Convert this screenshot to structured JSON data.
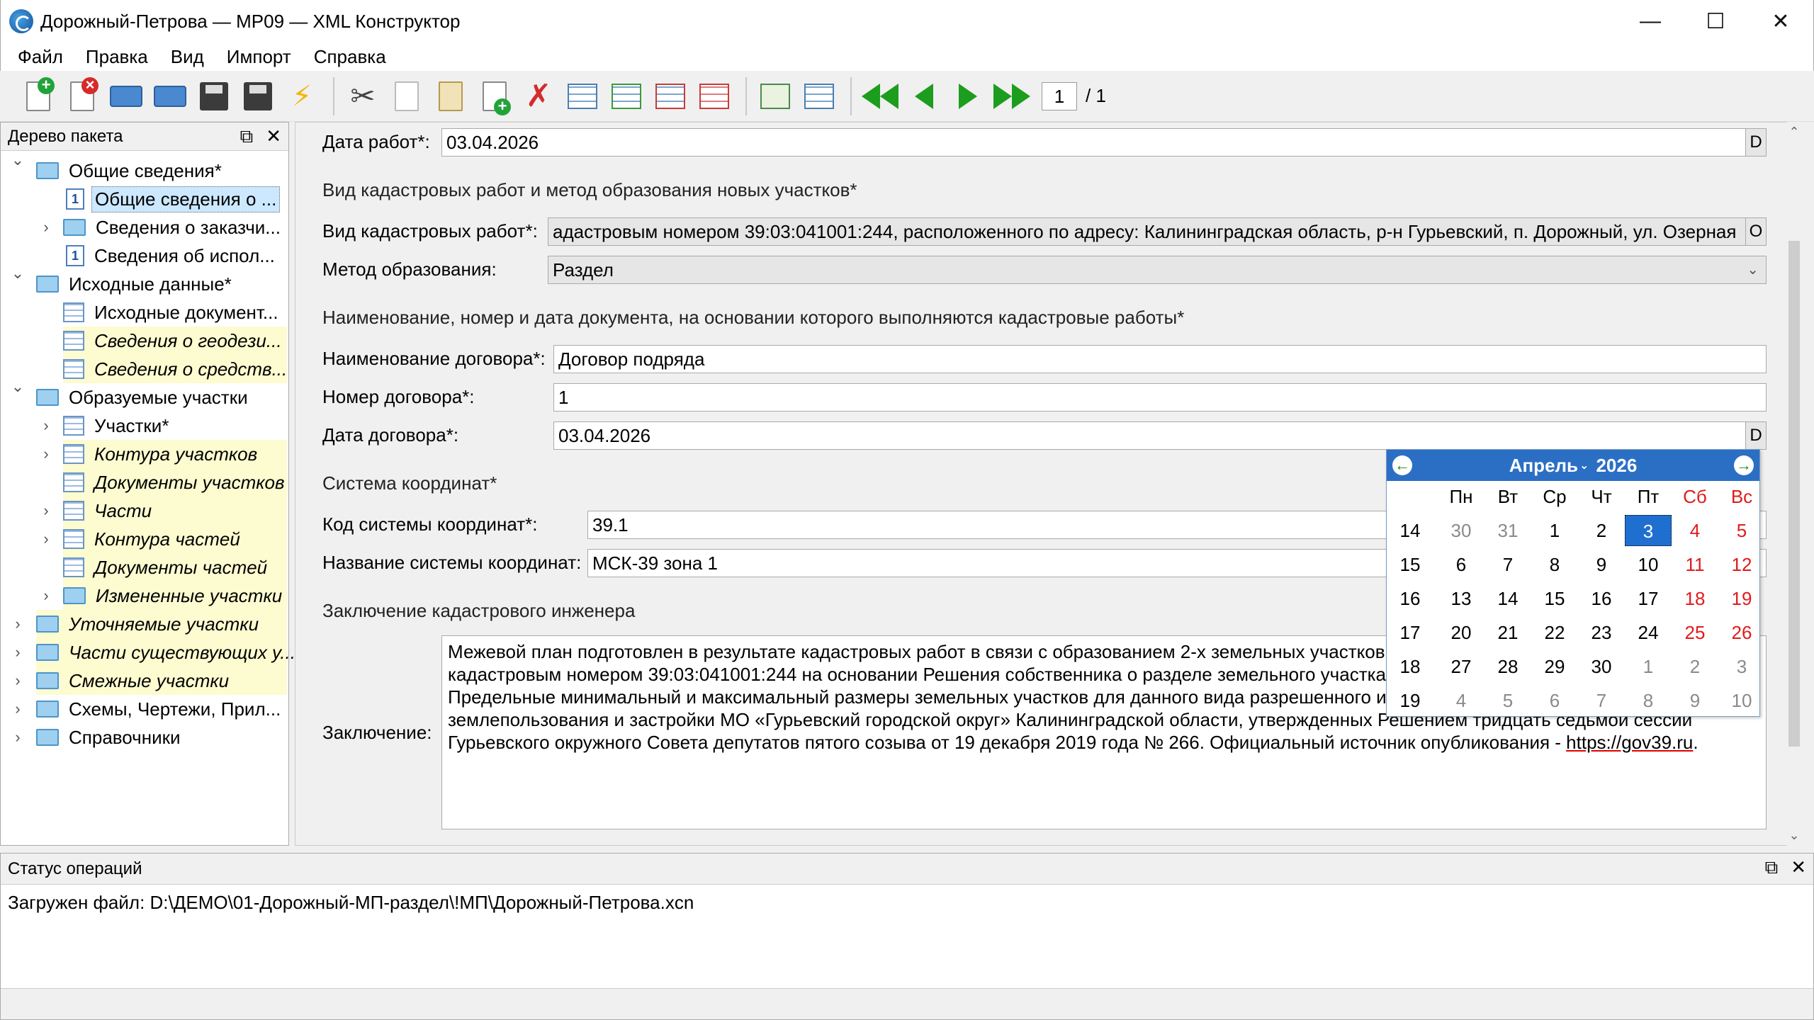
{
  "window": {
    "title": "Дорожный-Петрова — МР09 — XML Конструктор",
    "minimize": "—",
    "maximize": "☐",
    "close": "✕"
  },
  "menu": [
    "Файл",
    "Правка",
    "Вид",
    "Импорт",
    "Справка"
  ],
  "toolbar": {
    "page_current": "1",
    "page_total": "/ 1"
  },
  "tree": {
    "header": "Дерево пакета",
    "items": [
      {
        "label": "Общие сведения*",
        "expander": "v",
        "icon": "folder",
        "italic": false,
        "highlight": false
      },
      {
        "label": "Общие сведения о ...",
        "expander": "",
        "icon": "doc1",
        "italic": false,
        "highlight": false,
        "selected": true
      },
      {
        "label": "Сведения о заказчи...",
        "expander": ">",
        "icon": "folder",
        "italic": false,
        "highlight": false
      },
      {
        "label": "Сведения об испол...",
        "expander": "",
        "icon": "doc1",
        "italic": false,
        "highlight": false
      },
      {
        "label": "Исходные данные*",
        "expander": "v",
        "icon": "folder",
        "italic": false,
        "highlight": false
      },
      {
        "label": "Исходные документ...",
        "expander": "",
        "icon": "table",
        "italic": false,
        "highlight": false
      },
      {
        "label": "Сведения о геодези...",
        "expander": "",
        "icon": "table",
        "italic": true,
        "highlight": true
      },
      {
        "label": "Сведения о средств...",
        "expander": "",
        "icon": "table",
        "italic": true,
        "highlight": true
      },
      {
        "label": "Образуемые участки",
        "expander": "v",
        "icon": "folder",
        "italic": false,
        "highlight": false
      },
      {
        "label": "Участки*",
        "expander": ">",
        "icon": "table",
        "italic": false,
        "highlight": false
      },
      {
        "label": "Контура участков",
        "expander": ">",
        "icon": "table",
        "italic": true,
        "highlight": true
      },
      {
        "label": "Документы участков",
        "expander": "",
        "icon": "table",
        "italic": true,
        "highlight": true
      },
      {
        "label": "Части",
        "expander": ">",
        "icon": "table",
        "italic": true,
        "highlight": true
      },
      {
        "label": "Контура частей",
        "expander": ">",
        "icon": "table",
        "italic": true,
        "highlight": true
      },
      {
        "label": "Документы частей",
        "expander": "",
        "icon": "table",
        "italic": true,
        "highlight": true
      },
      {
        "label": "Измененные участки",
        "expander": ">",
        "icon": "folder",
        "italic": true,
        "highlight": true
      },
      {
        "label": "Уточняемые участки",
        "expander": ">",
        "icon": "folder",
        "italic": true,
        "highlight": true
      },
      {
        "label": "Части существующих у...",
        "expander": ">",
        "icon": "folder",
        "italic": true,
        "highlight": true
      },
      {
        "label": "Смежные участки",
        "expander": ">",
        "icon": "folder",
        "italic": true,
        "highlight": true
      },
      {
        "label": "Схемы, Чертежи, Прил...",
        "expander": ">",
        "icon": "folder",
        "italic": false,
        "highlight": false
      },
      {
        "label": "Справочники",
        "expander": ">",
        "icon": "folder",
        "italic": false,
        "highlight": false
      }
    ]
  },
  "form": {
    "work_date_label": "Дата работ*:",
    "work_date_value": "03.04.2026",
    "d_button": "D",
    "section_kind": "Вид кадастровых работ и метод образования новых участков*",
    "kind_label": "Вид кадастровых работ*:",
    "kind_value": "адастровым номером 39:03:041001:244, расположенного по адресу: Калининградская область, р-н Гурьевский, п. Дорожный, ул. Озерная",
    "o_button": "O",
    "method_label": "Метод образования:",
    "method_value": "Раздел",
    "section_doc": "Наименование, номер и дата документа, на основании которого выполняются кадастровые работы*",
    "contract_name_label": "Наименование договора*:",
    "contract_name_value": "Договор подряда",
    "contract_num_label": "Номер договора*:",
    "contract_num_value": "1",
    "contract_date_label": "Дата договора*:",
    "contract_date_value": "03.04.2026",
    "section_coord": "Система координат*",
    "coord_code_label": "Код системы координат*:",
    "coord_code_value": "39.1",
    "coord_name_label": "Название системы координат:",
    "coord_name_value": "МСК-39 зона 1",
    "section_conclusion": "Заключение кадастрового инженера",
    "conclusion_label": "Заключение:",
    "conclusion_lines": [
      "Межевой план подготовлен в результате кадастровых работ в связи с образованием 2-х земельных участков",
      "кадастровым номером 39:03:041001:244 на основании Решения собственника о разделе земельного участка.",
      "Предельные минимальный и максимальный размеры земельных участков для данного вида разрешенного ис",
      "землепользования и застройки МО «Гурьевский городской округ» Калининградской области, утвержденных Решением тридцать седьмой сессии",
      "Гурьевского окружного Совета депутатов пятого созыва от 19 декабря 2019 года № 266. Официальный источник опубликования - https://gov39.ru."
    ]
  },
  "calendar": {
    "month": "Апрель",
    "year": "2026",
    "dow": [
      "Пн",
      "Вт",
      "Ср",
      "Чт",
      "Пт",
      "Сб",
      "Вс"
    ],
    "weeks": [
      {
        "num": "14",
        "days": [
          "30",
          "31",
          "1",
          "2",
          "3",
          "4",
          "5"
        ]
      },
      {
        "num": "15",
        "days": [
          "6",
          "7",
          "8",
          "9",
          "10",
          "11",
          "12"
        ]
      },
      {
        "num": "16",
        "days": [
          "13",
          "14",
          "15",
          "16",
          "17",
          "18",
          "19"
        ]
      },
      {
        "num": "17",
        "days": [
          "20",
          "21",
          "22",
          "23",
          "24",
          "25",
          "26"
        ]
      },
      {
        "num": "18",
        "days": [
          "27",
          "28",
          "29",
          "30",
          "1",
          "2",
          "3"
        ]
      },
      {
        "num": "19",
        "days": [
          "4",
          "5",
          "6",
          "7",
          "8",
          "9",
          "10"
        ]
      }
    ],
    "selected": "3"
  },
  "status": {
    "header": "Статус операций",
    "message": "Загружен файл: D:\\ДЕМО\\01-Дорожный-МП-раздел\\!МП\\Дорожный-Петрова.xcn"
  },
  "colors": {
    "calendar_header": "#2b6fc5",
    "weekend": "#e01b1b",
    "highlight_row": "#fdfbd0",
    "selection": "#cce8ff"
  }
}
